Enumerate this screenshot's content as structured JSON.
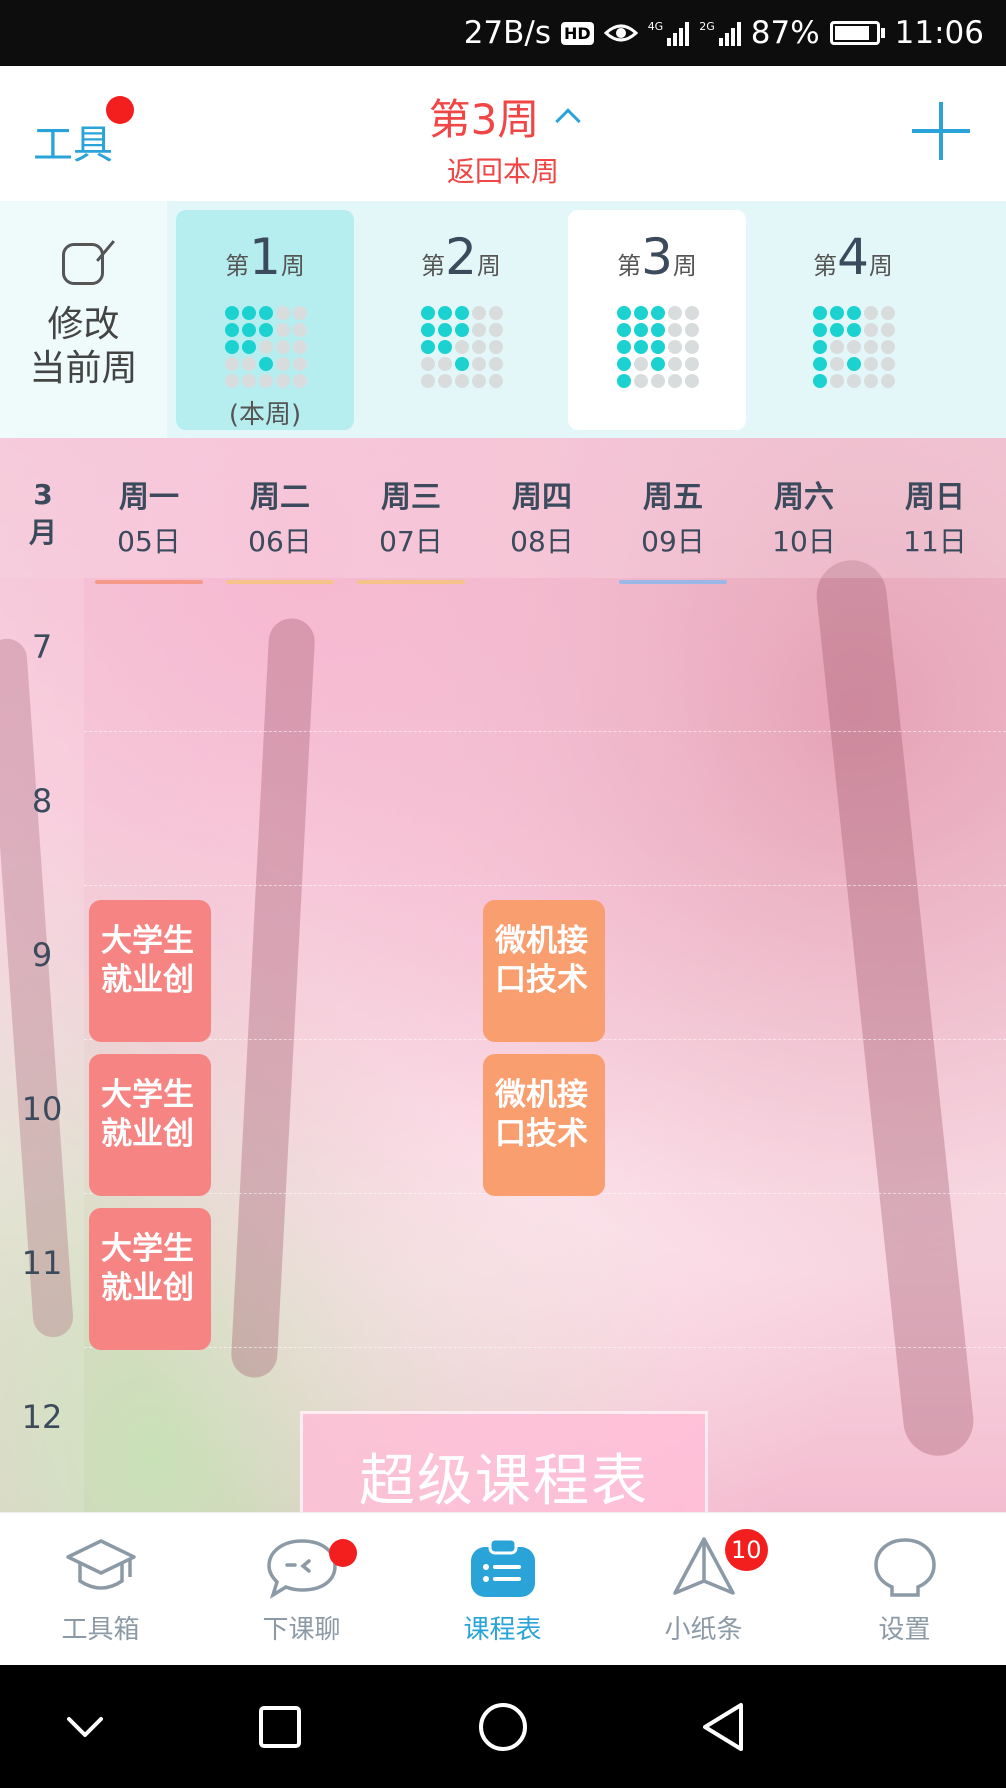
{
  "status_bar": {
    "speed": "27B/s",
    "hd": "HD",
    "net1": "4G",
    "net2": "2G",
    "battery": "87%",
    "time": "11:06"
  },
  "header": {
    "tools": "工具",
    "week_title": "第3周",
    "back_to_current": "返回本周"
  },
  "week_strip": {
    "edit_line1": "修改",
    "edit_line2": "当前周",
    "weeks": [
      {
        "prefix": "第",
        "num": "1",
        "suffix": "周",
        "sub": "(本周)"
      },
      {
        "prefix": "第",
        "num": "2",
        "suffix": "周"
      },
      {
        "prefix": "第",
        "num": "3",
        "suffix": "周"
      },
      {
        "prefix": "第",
        "num": "4",
        "suffix": "周"
      }
    ]
  },
  "schedule": {
    "month_num": "3",
    "month_unit": "月",
    "days": [
      {
        "name": "周一",
        "date": "05日"
      },
      {
        "name": "周二",
        "date": "06日"
      },
      {
        "name": "周三",
        "date": "07日"
      },
      {
        "name": "周四",
        "date": "08日"
      },
      {
        "name": "周五",
        "date": "09日"
      },
      {
        "name": "周六",
        "date": "10日"
      },
      {
        "name": "周日",
        "date": "11日"
      }
    ],
    "hours": [
      "7",
      "8",
      "9",
      "10",
      "11",
      "12"
    ],
    "courses": [
      {
        "title": "大学生就业创",
        "day": "周一",
        "start": "9"
      },
      {
        "title": "大学生就业创",
        "day": "周一",
        "start": "10"
      },
      {
        "title": "大学生就业创",
        "day": "周一",
        "start": "11"
      },
      {
        "title": "微机接口技术",
        "day": "周四",
        "start": "9"
      },
      {
        "title": "微机接口技术",
        "day": "周四",
        "start": "10"
      }
    ],
    "brand": "超级课程表"
  },
  "bottom_nav": [
    {
      "label": "工具箱",
      "icon": "graduation-cap-icon"
    },
    {
      "label": "下课聊",
      "icon": "chat-bubble-icon"
    },
    {
      "label": "课程表",
      "icon": "schedule-icon",
      "active": true
    },
    {
      "label": "小纸条",
      "icon": "paper-plane-icon",
      "badge": "10"
    },
    {
      "label": "设置",
      "icon": "settings-icon"
    }
  ],
  "colors": {
    "accent": "#2aa4d8",
    "alert": "#f04646",
    "course_red": "#f58483",
    "course_orange": "#f99e6f",
    "teal": "#1bd2d0"
  }
}
